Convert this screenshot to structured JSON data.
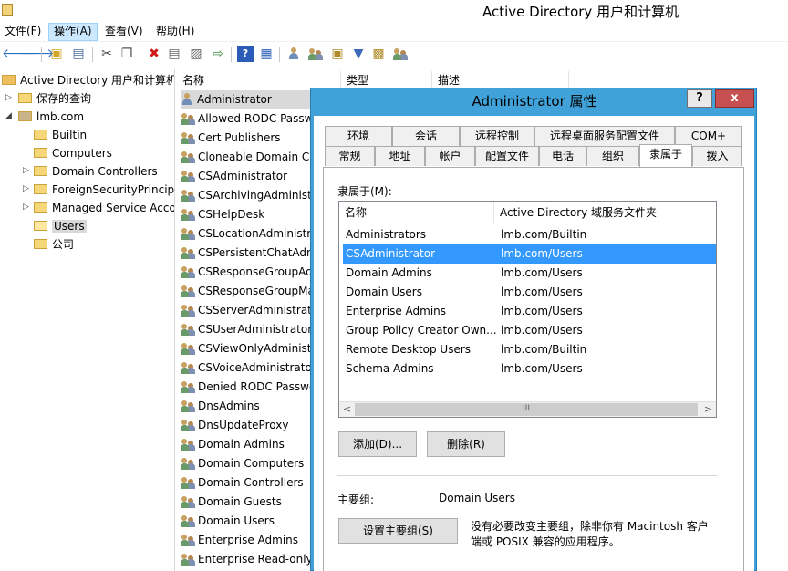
{
  "window": {
    "title": "Active Directory 用户和计算机"
  },
  "menu": [
    {
      "label": "文件(F)"
    },
    {
      "label": "操作(A)"
    },
    {
      "label": "查看(V)"
    },
    {
      "label": "帮助(H)"
    }
  ],
  "toolbar_icons": [
    "back-icon",
    "forward-icon",
    "up-folder-icon",
    "show-console-tree-icon",
    "cut-icon",
    "copy-icon",
    "delete-icon",
    "properties-icon",
    "refresh-icon",
    "export-list-icon",
    "help-icon",
    "console-icon",
    "new-user-icon",
    "new-group-icon",
    "new-ou-icon",
    "filter-icon",
    "find-icon",
    "add-to-group-icon"
  ],
  "tree": {
    "root": "Active Directory 用户和计算机",
    "saved_queries": "保存的查询",
    "domain": "lmb.com",
    "children": [
      "Builtin",
      "Computers",
      "Domain Controllers",
      "ForeignSecurityPrincipals",
      "Managed Service Accounts",
      "Users",
      "公司"
    ],
    "selected": "Users"
  },
  "list": {
    "columns": [
      "名称",
      "类型",
      "描述"
    ],
    "rows": [
      "Administrator",
      "Allowed RODC Password Replication Group",
      "Cert Publishers",
      "Cloneable Domain Controllers",
      "CSAdministrator",
      "CSArchivingAdministrator",
      "CSHelpDesk",
      "CSLocationAdministrator",
      "CSPersistentChatAdministrator",
      "CSResponseGroupAdministrator",
      "CSResponseGroupManager",
      "CSServerAdministrator",
      "CSUserAdministrator",
      "CSViewOnlyAdministrator",
      "CSVoiceAdministrator",
      "Denied RODC Password Replication Group",
      "DnsAdmins",
      "DnsUpdateProxy",
      "Domain Admins",
      "Domain Computers",
      "Domain Controllers",
      "Domain Guests",
      "Domain Users",
      "Enterprise Admins",
      "Enterprise Read-only Domain Controllers"
    ],
    "selected": "Administrator"
  },
  "dialog": {
    "title": "Administrator 属性",
    "help": "?",
    "close": "x",
    "tabs_row1": [
      "环境",
      "会话",
      "远程控制",
      "远程桌面服务配置文件",
      "COM+"
    ],
    "tabs_row2": [
      "常规",
      "地址",
      "帐户",
      "配置文件",
      "电话",
      "组织",
      "隶属于",
      "拨入"
    ],
    "active_tab": "隶属于",
    "member_of_label": "隶属于(M):",
    "columns": [
      "名称",
      "Active Directory 域服务文件夹"
    ],
    "members": [
      {
        "name": "Administrators",
        "folder": "lmb.com/Builtin"
      },
      {
        "name": "CSAdministrator",
        "folder": "lmb.com/Users"
      },
      {
        "name": "Domain Admins",
        "folder": "lmb.com/Users"
      },
      {
        "name": "Domain Users",
        "folder": "lmb.com/Users"
      },
      {
        "name": "Enterprise Admins",
        "folder": "lmb.com/Users"
      },
      {
        "name": "Group Policy Creator Own...",
        "folder": "lmb.com/Users"
      },
      {
        "name": "Remote Desktop Users",
        "folder": "lmb.com/Builtin"
      },
      {
        "name": "Schema Admins",
        "folder": "lmb.com/Users"
      }
    ],
    "selected_member": "CSAdministrator",
    "add_button": "添加(D)...",
    "remove_button": "删除(R)",
    "primary_group_label": "主要组:",
    "primary_group_value": "Domain Users",
    "set_primary_button": "设置主要组(S)",
    "note_line1": "没有必要改变主要组，除非你有 Macintosh 客户",
    "note_line2": "端或 POSIX 兼容的应用程序。",
    "scroll_left": "<",
    "scroll_right": ">",
    "scroll_grip": "III"
  },
  "colors": {
    "selection_blue": "#3399ff",
    "dialog_frame": "#41a2d9",
    "close_red": "#c75050"
  }
}
